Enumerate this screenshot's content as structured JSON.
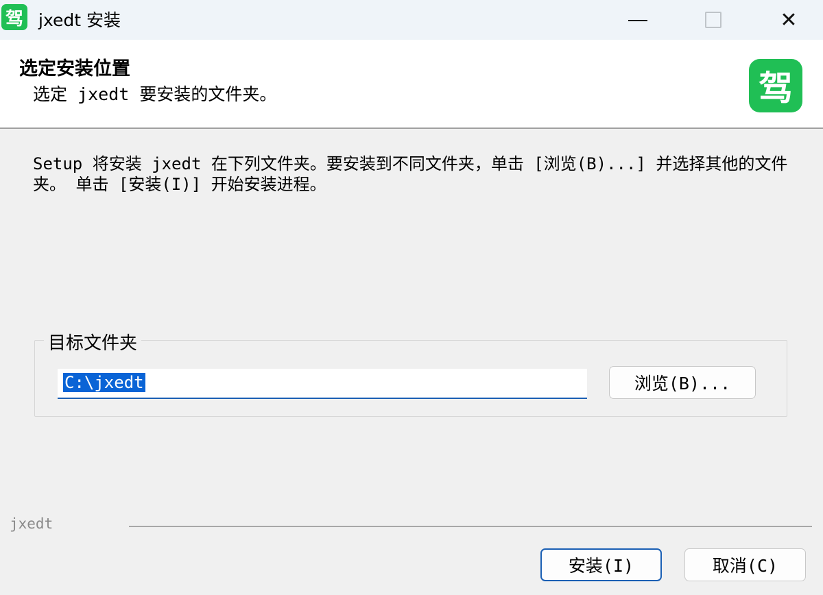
{
  "window": {
    "icon_glyph": "驾",
    "title": "jxedt 安装",
    "controls": [
      "minimize-icon",
      "maximize-icon",
      "close-icon"
    ],
    "close_glyph": "✕"
  },
  "header": {
    "title": "选定安装位置",
    "subtitle": "选定 jxedt 要安装的文件夹。",
    "logo_glyph": "驾"
  },
  "body": {
    "description": "Setup 将安装 jxedt 在下列文件夹。要安装到不同文件夹，单击 [浏览(B)...] 并选择其他的文件夹。 单击 [安装(I)] 开始安装进程。"
  },
  "destination": {
    "group_label": "目标文件夹",
    "path_value": "C:\\jxedt",
    "browse_label": "浏览(B)..."
  },
  "footer": {
    "brand": "jxedt",
    "install_label": "安装(I)",
    "cancel_label": "取消(C)"
  },
  "colors": {
    "accent": "#20bf55",
    "focus": "#1a5fb4",
    "selection": "#0a64d6"
  }
}
